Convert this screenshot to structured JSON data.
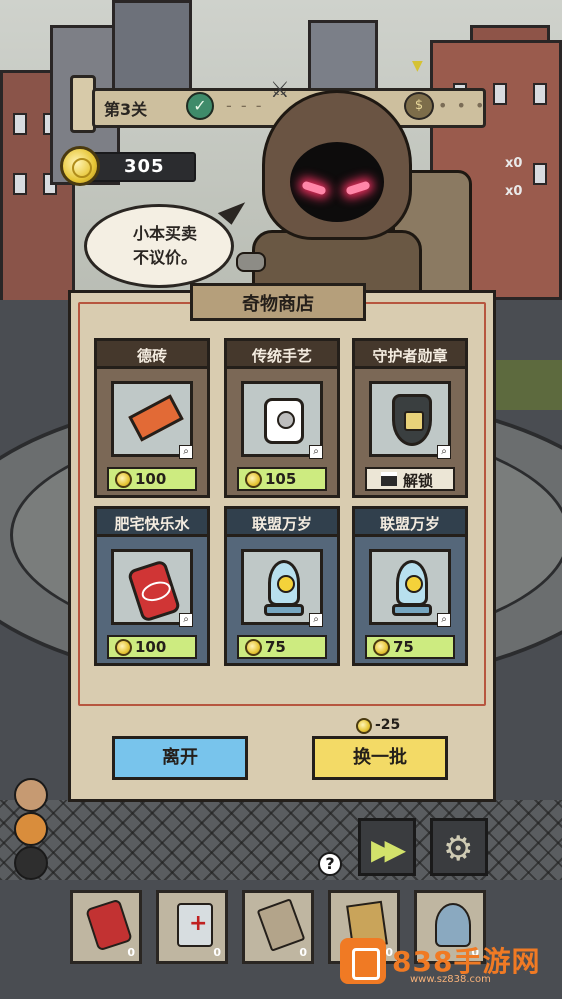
{
  "hud": {
    "stage_label": "第3关",
    "coins": "305",
    "markers": [
      "x0",
      "x0"
    ]
  },
  "merchant": {
    "speech_line1": "小本买卖",
    "speech_line2": "不议价。"
  },
  "shop": {
    "title": "奇物商店",
    "items": [
      {
        "name": "德砖",
        "price": "100",
        "price_type": "coin",
        "icon": "brick-icon",
        "style": "brown"
      },
      {
        "name": "传统手艺",
        "price": "105",
        "price_type": "coin",
        "icon": "toilet-paper-icon",
        "style": "brown"
      },
      {
        "name": "守护者勋章",
        "price": "解锁",
        "price_type": "unlock",
        "icon": "guardian-shield-icon",
        "style": "brown"
      },
      {
        "name": "肥宅快乐水",
        "price": "100",
        "price_type": "coin",
        "icon": "soda-can-icon",
        "style": "blue"
      },
      {
        "name": "联盟万岁",
        "price": "75",
        "price_type": "coin",
        "icon": "nuke-bomb-icon",
        "style": "blue"
      },
      {
        "name": "联盟万岁",
        "price": "75",
        "price_type": "coin",
        "icon": "nuke-bomb-icon",
        "style": "blue"
      }
    ],
    "refresh_cost": "-25",
    "leave_label": "离开",
    "refresh_label": "换一批"
  },
  "controls": {
    "help": "?"
  },
  "inventory": [
    {
      "icon": "soda-can-icon",
      "count": "0"
    },
    {
      "icon": "medkit-icon",
      "count": "0"
    },
    {
      "icon": "scroll-icon",
      "count": "0"
    },
    {
      "icon": "map-icon",
      "count": "0"
    },
    {
      "icon": "bomb-icon",
      "count": "0"
    }
  ],
  "watermark": {
    "text": "838手游网",
    "sub": "www.sz838.com"
  },
  "colors": {
    "price_green": "#cdeb80",
    "leave_blue": "#78c4ec",
    "refresh_yellow": "#f3da66",
    "panel_paper": "#d9ccb0"
  }
}
